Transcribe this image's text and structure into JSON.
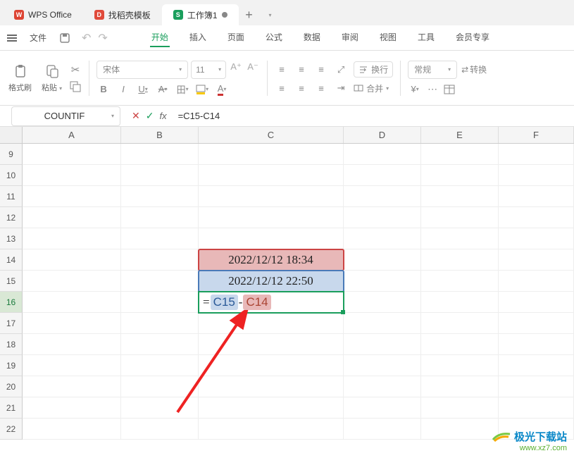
{
  "tabs": [
    {
      "label": "WPS Office",
      "icon_bg": "#d43",
      "icon_text": "W"
    },
    {
      "label": "找稻壳模板",
      "icon_bg": "#e04a3a",
      "icon_text": "D"
    },
    {
      "label": "工作簿1",
      "icon_bg": "#1a9e5c",
      "icon_text": "S"
    }
  ],
  "menu": {
    "file": "文件",
    "items": [
      "开始",
      "插入",
      "页面",
      "公式",
      "数据",
      "审阅",
      "视图",
      "工具",
      "会员专享"
    ],
    "active_index": 0
  },
  "toolbar": {
    "format_brush": "格式刷",
    "paste": "粘贴",
    "font_name": "宋体",
    "font_size": "11",
    "wrap": "换行",
    "merge": "合并",
    "number_format": "常规",
    "convert": "转换"
  },
  "formula_bar": {
    "name_box": "COUNTIF",
    "formula": "=C15-C14"
  },
  "columns": [
    "A",
    "B",
    "C",
    "D",
    "E",
    "F"
  ],
  "rows_start": 9,
  "rows_end": 22,
  "active_row": 16,
  "cells": {
    "C14": "2022/12/12 18:34",
    "C15": "2022/12/12 22:50",
    "C16_prefix": "=",
    "C16_ref1": "C15",
    "C16_op": "-",
    "C16_ref2": "C14"
  },
  "watermark": {
    "name": "极光下载站",
    "url": "www.xz7.com"
  }
}
